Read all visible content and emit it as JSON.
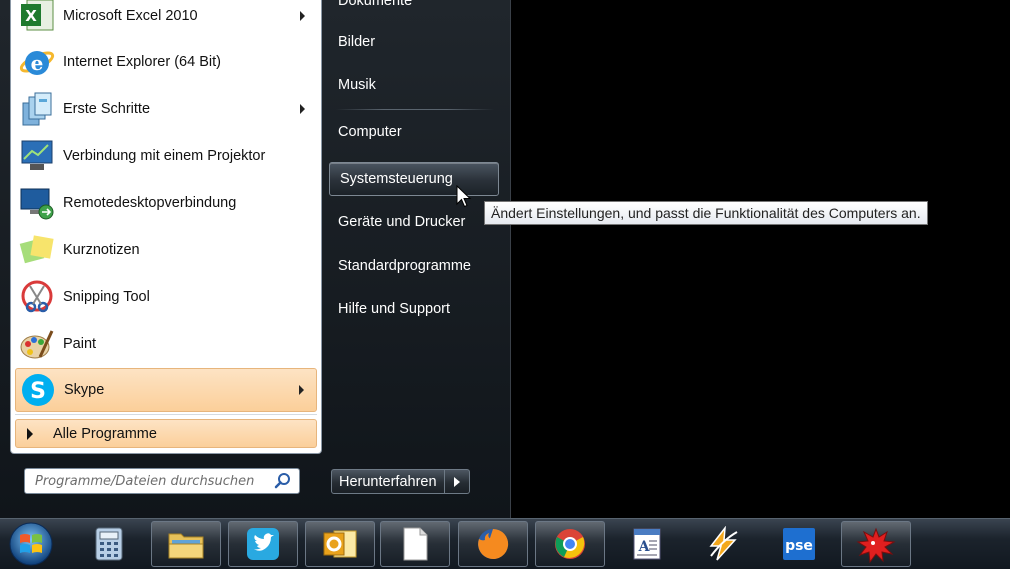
{
  "start_menu": {
    "programs": [
      {
        "label": "Microsoft Excel 2010",
        "icon": "excel-icon",
        "submenu": true
      },
      {
        "label": "Internet Explorer (64 Bit)",
        "icon": "internet-explorer-icon",
        "submenu": false
      },
      {
        "label": "Erste Schritte",
        "icon": "getting-started-icon",
        "submenu": true
      },
      {
        "label": "Verbindung mit einem Projektor",
        "icon": "projector-icon",
        "submenu": false
      },
      {
        "label": "Remotedesktopverbindung",
        "icon": "remote-desktop-icon",
        "submenu": false
      },
      {
        "label": "Kurznotizen",
        "icon": "sticky-notes-icon",
        "submenu": false
      },
      {
        "label": "Snipping Tool",
        "icon": "snipping-tool-icon",
        "submenu": false
      },
      {
        "label": "Paint",
        "icon": "paint-icon",
        "submenu": false
      },
      {
        "label": "Skype",
        "icon": "skype-icon",
        "submenu": true
      }
    ],
    "all_programs_label": "Alle Programme",
    "search": {
      "placeholder": "Programme/Dateien durchsuchen",
      "value": ""
    },
    "right_items": [
      {
        "label": "Dokumente"
      },
      {
        "label": "Bilder"
      },
      {
        "label": "Musik"
      },
      {
        "label": "Computer"
      },
      {
        "label": "Systemsteuerung"
      },
      {
        "label": "Geräte und Drucker"
      },
      {
        "label": "Standardprogramme"
      },
      {
        "label": "Hilfe und Support"
      }
    ],
    "shutdown_label": "Herunterfahren",
    "tooltip": "Ändert Einstellungen, und passt die Funktionalität des Computers an."
  },
  "taskbar": {
    "buttons": [
      {
        "name": "calculator-icon"
      },
      {
        "name": "file-explorer-icon"
      },
      {
        "name": "twitter-icon"
      },
      {
        "name": "outlook-icon"
      },
      {
        "name": "blank-document-icon"
      },
      {
        "name": "firefox-icon"
      },
      {
        "name": "chrome-icon"
      },
      {
        "name": "wordpad-icon"
      },
      {
        "name": "winamp-icon"
      },
      {
        "name": "photoshop-elements-icon"
      },
      {
        "name": "red-splat-icon"
      }
    ]
  },
  "colors": {
    "menu_highlight": "#fbcf9a",
    "taskbar": "#1b232c",
    "skype_blue": "#00aff0"
  }
}
